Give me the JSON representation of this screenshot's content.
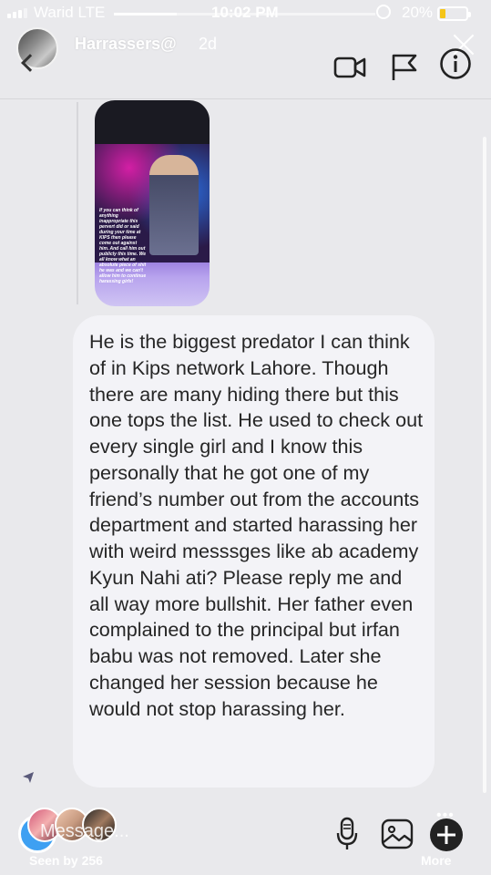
{
  "status_bar": {
    "carrier": "Warid  LTE",
    "time": "10:02 PM",
    "battery": "20%",
    "battery_level": 0.2,
    "story_progress": 0.24
  },
  "header": {
    "username": "Harrassers@",
    "post_time": "2d",
    "icons": [
      "back-arrow-icon",
      "video-icon",
      "flag-icon",
      "info-icon",
      "close-icon"
    ]
  },
  "shared_post": {
    "caption": "If you can think of anything inappropriate this pervert did or said during your time at KIPS then please come out against him. And call him out publicly this time. We all know what an absolute piece of shit he was and we can't allow him to continue harassing girls!"
  },
  "message": {
    "text": "He is the biggest predator I can think of in Kips network Lahore. Though there are many hiding there but this one tops the list. He used to check out every single girl and I know this personally that he got one of my friend’s number out from the accounts department and started harassing her with weird messsges like ab academy Kyun Nahi ati? Please reply me and all way more bullshit. Her father even complained to the principal but irfan babu was not removed. Later she changed her session because he would not stop harassing her."
  },
  "bottom_bar": {
    "message_placeholder": "Message...",
    "seen_by": "Seen by 256",
    "more_label": "More",
    "icons": [
      "camera-icon",
      "mic-icon",
      "gallery-icon",
      "plus-icon"
    ]
  },
  "colors": {
    "background": "#e9e9ec",
    "bubble": "#f3f3f7",
    "camera_button": "#3ea0f2",
    "battery_fill": "#f5c518"
  }
}
